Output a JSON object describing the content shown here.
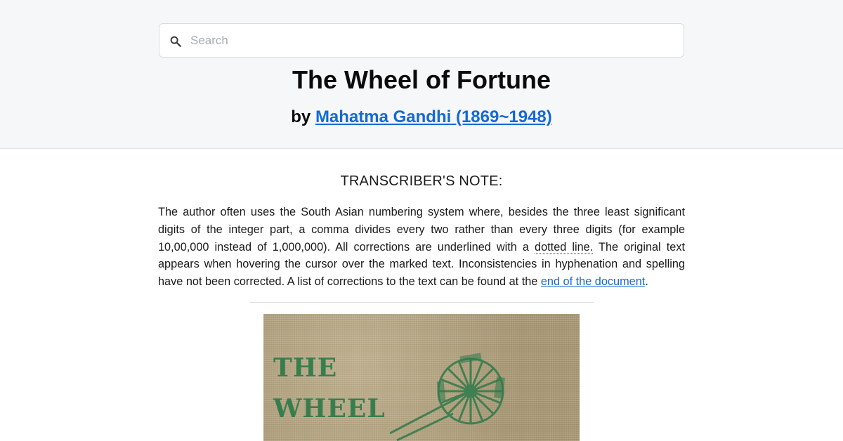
{
  "search": {
    "placeholder": "Search",
    "icon": "search-icon"
  },
  "book": {
    "title": "The Wheel of Fortune",
    "by_prefix": "by",
    "author_link": "Mahatma Gandhi (1869~1948)"
  },
  "note": {
    "heading": "TRANSCRIBER'S NOTE:",
    "text_part1": "The author often uses the South Asian numbering system where, besides the three least significant digits of the integer part, a comma divides every two rather than every three digits (for example 10,00,000 instead of 1,000,000). All corrections are underlined with a ",
    "dotted_text": "dotted line.",
    "text_part2": " The original text appears when hovering the cursor over the marked text. Inconsistencies in hyphenation and spelling have not been corrected. A list of corrections to the text can be found at the ",
    "link_text": "end of the document",
    "text_end": "."
  },
  "cover": {
    "line1": "THE",
    "line2": "WHEEL",
    "ink_color": "#2e7a4a"
  },
  "colors": {
    "link": "#1469d6",
    "header_bg": "#f6f7f9"
  }
}
